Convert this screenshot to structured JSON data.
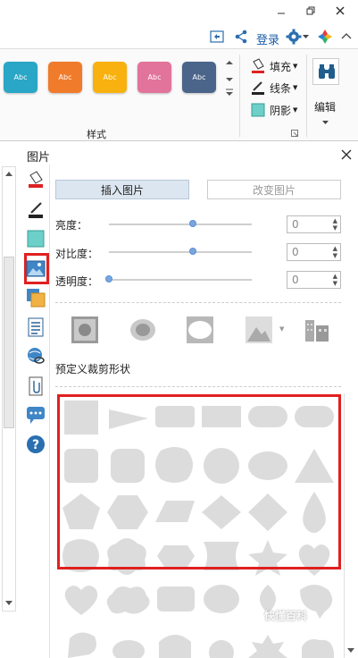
{
  "quickbar": {
    "login": "登录"
  },
  "ribbon": {
    "styles": [
      {
        "label": "Abc",
        "color": "#2aa6c6"
      },
      {
        "label": "Abc",
        "color": "#f07b2b"
      },
      {
        "label": "Abc",
        "color": "#f8b10e"
      },
      {
        "label": "Abc",
        "color": "#e2739a"
      },
      {
        "label": "Abc",
        "color": "#4b6489"
      }
    ],
    "group_label": "样式",
    "fill": "填充",
    "line": "线条",
    "shadow": "阴影",
    "edit": "编辑"
  },
  "panel": {
    "title": "图片",
    "insert_btn": "插入图片",
    "change_btn": "改变图片",
    "brightness": {
      "label": "亮度：",
      "value": "0",
      "level": 0.59
    },
    "contrast": {
      "label": "对比度：",
      "value": "0",
      "level": 0.59
    },
    "transparency": {
      "label": "透明度：",
      "value": "0",
      "level": 0.0
    },
    "crop_label": "预定义裁剪形状"
  },
  "watermark": "快懂百科"
}
